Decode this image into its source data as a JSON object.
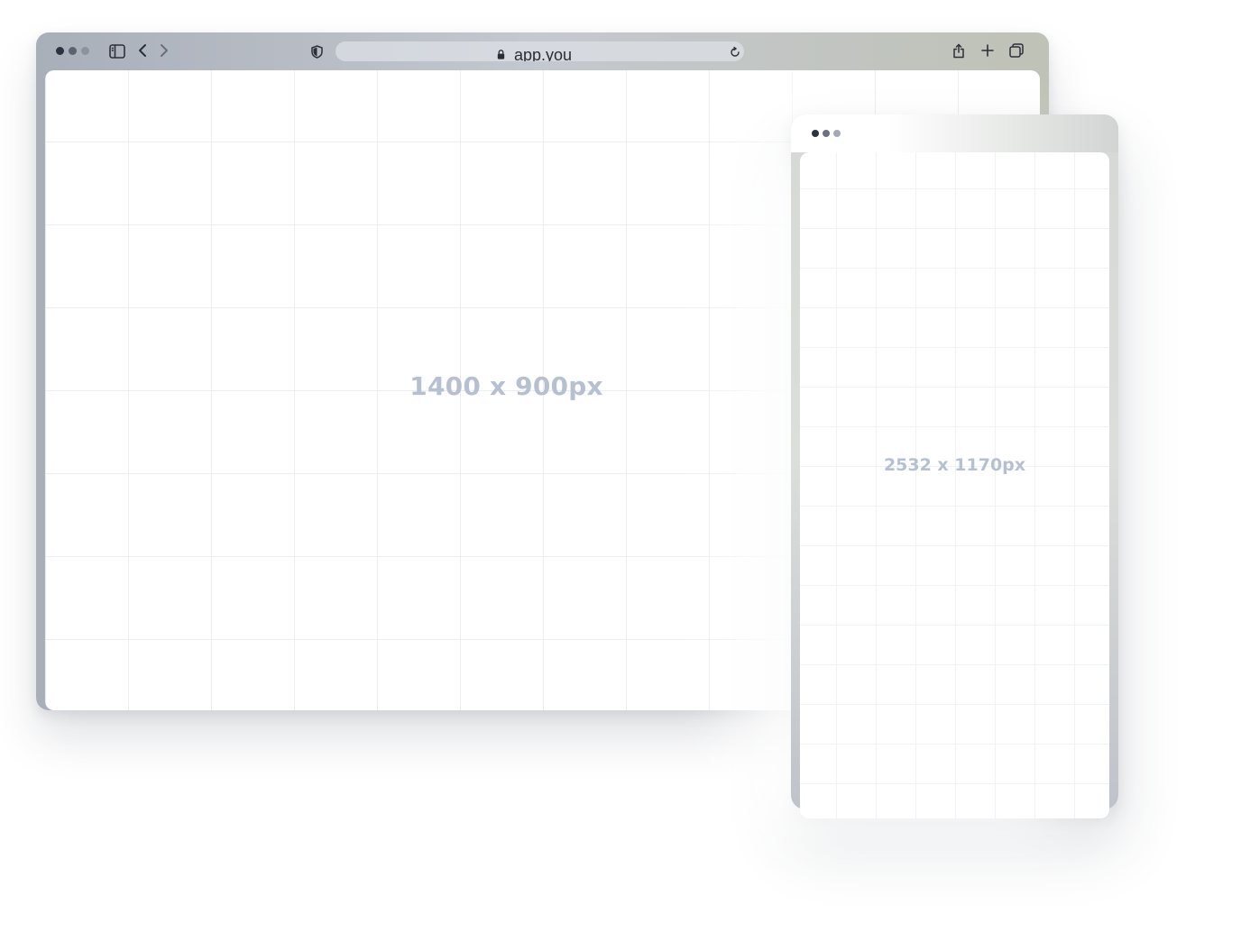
{
  "browser": {
    "address_bar": {
      "url": "app.your..."
    },
    "viewport_label": "1400 x 900px",
    "icons": {
      "sidebar": "sidebar-icon",
      "back": "chevron-left-icon",
      "forward": "chevron-right-icon",
      "privacy": "shield-icon",
      "lock": "lock-icon",
      "reload": "reload-icon",
      "share": "share-icon",
      "new_tab": "plus-icon",
      "tabs": "tabs-overview-icon"
    }
  },
  "phone": {
    "screen_label": "2532 x 1170px"
  },
  "colors": {
    "label_text": "#b6c0d0",
    "grid_line": "#ebedf1",
    "chrome_dark": "#2e3240"
  }
}
